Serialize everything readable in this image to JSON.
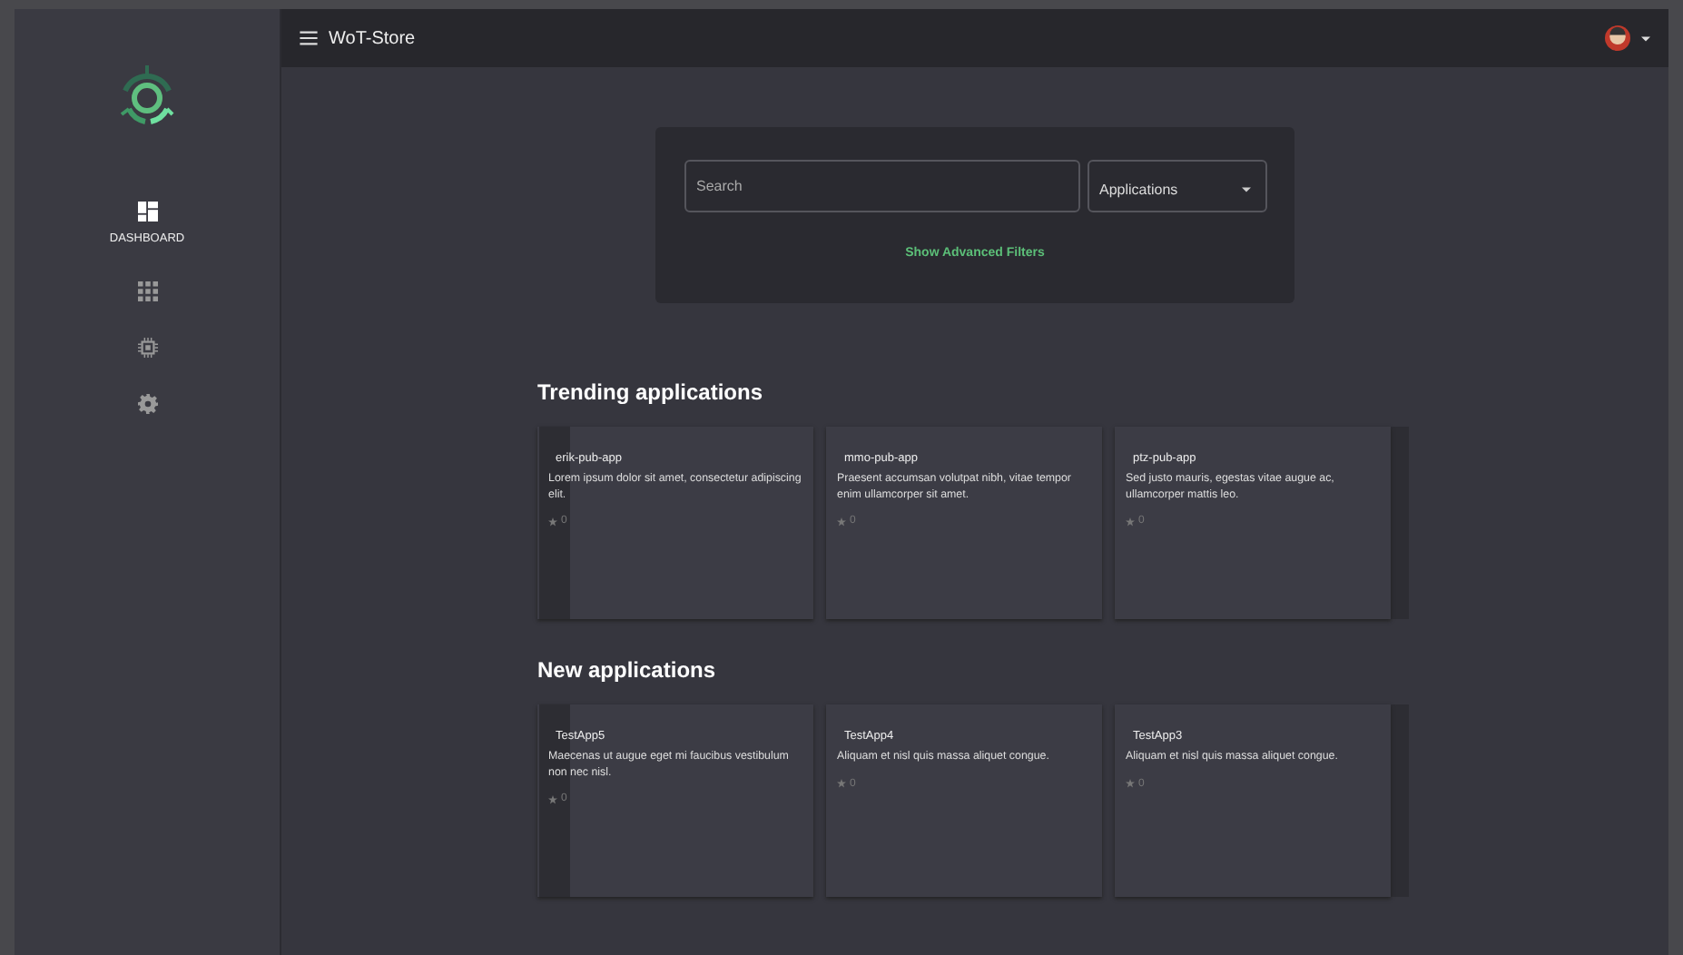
{
  "topbar": {
    "title": "WoT-Store"
  },
  "sidebar": {
    "items": [
      {
        "kind": "dashboard",
        "label": "DASHBOARD",
        "selected": true
      },
      {
        "kind": "apps",
        "selected": false
      },
      {
        "kind": "chip",
        "selected": false
      },
      {
        "kind": "settings",
        "selected": false
      }
    ]
  },
  "search": {
    "placeholder": "Search",
    "category": "Applications",
    "advanced_link": "Show Advanced Filters"
  },
  "sections": [
    {
      "title": "Trending applications",
      "cards": [
        {
          "name": "erik-pub-app",
          "description": "Lorem ipsum dolor sit amet, consectetur adipiscing elit.",
          "stars": "0"
        },
        {
          "name": "mmo-pub-app",
          "description": "Praesent accumsan volutpat nibh, vitae tempor enim ullamcorper sit amet.",
          "stars": "0"
        },
        {
          "name": "ptz-pub-app",
          "description": "Sed justo mauris, egestas vitae augue ac, ullamcorper mattis leo.",
          "stars": "0"
        }
      ]
    },
    {
      "title": "New applications",
      "cards": [
        {
          "name": "TestApp5",
          "description": "Maecenas ut augue eget mi faucibus vestibulum non nec nisl.",
          "stars": "0"
        },
        {
          "name": "TestApp4",
          "description": "Aliquam et nisl quis massa aliquet congue.",
          "stars": "0"
        },
        {
          "name": "TestApp3",
          "description": "Aliquam et nisl quis massa aliquet congue.",
          "stars": "0"
        }
      ]
    }
  ]
}
